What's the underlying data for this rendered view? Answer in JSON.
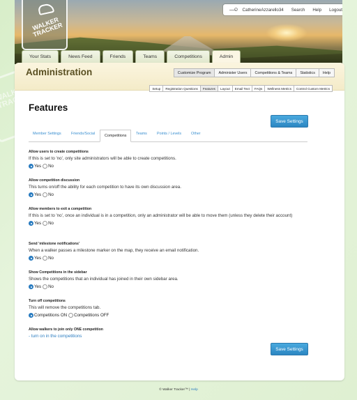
{
  "header": {
    "logo_text": "WALKER TRACKER",
    "user": {
      "username": "CatherineAzzarello34",
      "search_label": "Search",
      "help_label": "Help",
      "logout_label": "Logout"
    },
    "nav": [
      "Your Stats",
      "News Feed",
      "Friends",
      "Teams",
      "Competitions",
      "Admin"
    ],
    "active_nav": "Admin"
  },
  "panel": {
    "title": "Administration",
    "subnav": [
      "Customize Program",
      "Administer Users",
      "Competitions & Teams",
      "Statistics",
      "Help"
    ],
    "subnav_active": "Customize Program",
    "subsubnav": [
      "Setup",
      "Registration Questions",
      "Features",
      "Layout",
      "Email Text",
      "FAQs",
      "Wellness Metrics",
      "Control Custom Metrics"
    ],
    "subsubnav_active": "Features"
  },
  "page": {
    "title": "Features",
    "save_label": "Save Settings",
    "tabs": [
      "Member Settings",
      "Friends/Social",
      "Competitions",
      "Teams",
      "Points / Levels",
      "Other"
    ],
    "active_tab": "Competitions"
  },
  "settings": [
    {
      "label": "Allow users to create competitions",
      "desc": "If this is set to 'no', only site administrators will be able to create competitions.",
      "options": [
        "Yes",
        "No"
      ],
      "selected": "Yes"
    },
    {
      "label": "Allow competition discussion",
      "desc": "This turns on/off the ability for each competition to have its own discussion area.",
      "options": [
        "Yes",
        "No"
      ],
      "selected": "Yes"
    },
    {
      "label": "Allow members to exit a competition",
      "desc": "If this is set to 'no', once an individual is in a competition, only an administrator will be able to move them (unless they delete their account)",
      "options": [
        "Yes",
        "No"
      ],
      "selected": "Yes"
    },
    {
      "label": "Send 'milestone notifications'",
      "desc": "When a walker passes a milestone marker on the map, they receive an email notification.",
      "options": [
        "Yes",
        "No"
      ],
      "selected": "Yes"
    },
    {
      "label": "Show Competitions in the sidebar",
      "desc": "Shows the competitions that an individual has joined in their own sidebar area.",
      "options": [
        "Yes",
        "No"
      ],
      "selected": "Yes"
    },
    {
      "label": "Turn off competitions",
      "desc": "This will remove the competitions tab.",
      "options": [
        "Competitions ON",
        "Competitions OFF"
      ],
      "selected": "Competitions ON"
    }
  ],
  "single_competition": {
    "label": "Allow walkers to join only ONE competition",
    "link": "- turn on in the competitions"
  },
  "footer": {
    "copyright": "© Walker Tracker™ |",
    "help": "Help"
  }
}
